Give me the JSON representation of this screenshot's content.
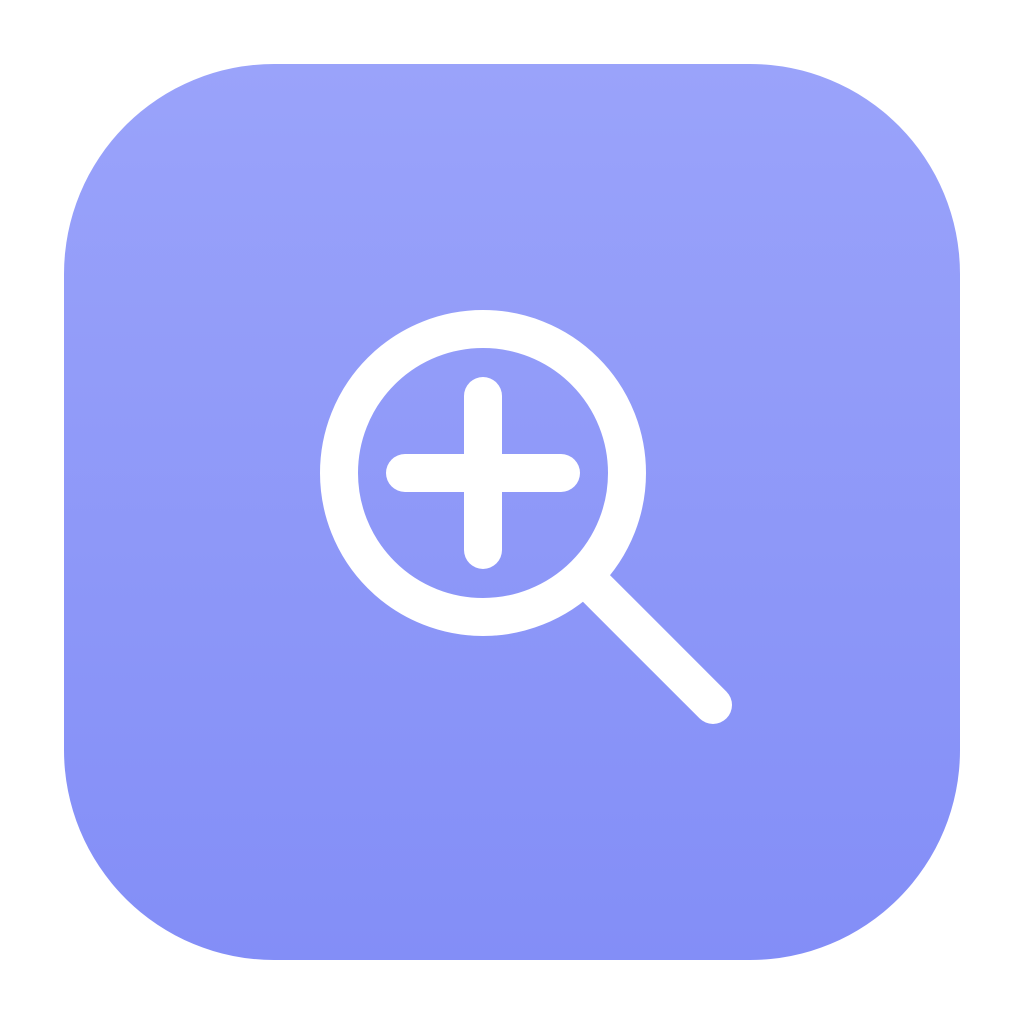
{
  "icon": {
    "name": "zoom-in-icon",
    "glyph": "magnifying-glass-with-plus",
    "colors": {
      "gradient_top": "#9AA3FA",
      "gradient_bottom": "#838EF7",
      "glyph": "#FFFFFF",
      "page_background": "#FFFFFF"
    }
  }
}
